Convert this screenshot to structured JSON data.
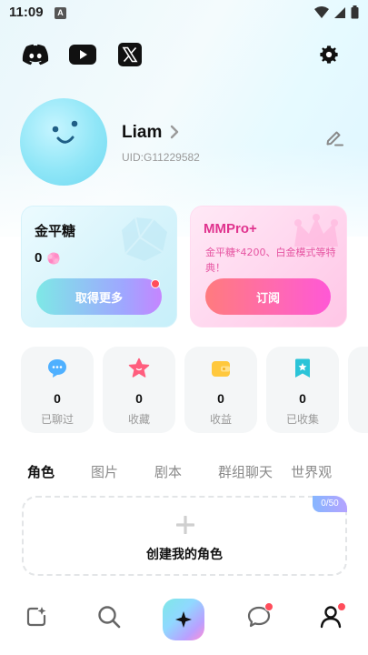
{
  "status_bar": {
    "time": "11:09",
    "notification_letter": "A"
  },
  "social": {
    "items": [
      "discord-icon",
      "youtube-icon",
      "x-icon"
    ]
  },
  "profile": {
    "name": "Liam",
    "uid": "UID:G11229582"
  },
  "cards": {
    "candy": {
      "title": "金平糖",
      "count": "0",
      "button_label": "取得更多"
    },
    "pro": {
      "title": "MMPro+",
      "description": "金平糖*4200、白金模式等特典！",
      "button_label": "订阅"
    }
  },
  "stats": [
    {
      "value": "0",
      "label": "已聊过",
      "icon": "chat-bubble-icon"
    },
    {
      "value": "0",
      "label": "收藏",
      "icon": "star-icon"
    },
    {
      "value": "0",
      "label": "收益",
      "icon": "wallet-icon"
    },
    {
      "value": "0",
      "label": "已收集",
      "icon": "bookmark-star-icon"
    }
  ],
  "tabs": [
    "角色",
    "图片",
    "剧本",
    "群组聊天",
    "世界观"
  ],
  "create": {
    "label": "创建我的角色",
    "counter": "0/50"
  },
  "colors": {
    "accent_pink": "#e0338e",
    "badge_red": "#ff4d5b"
  }
}
